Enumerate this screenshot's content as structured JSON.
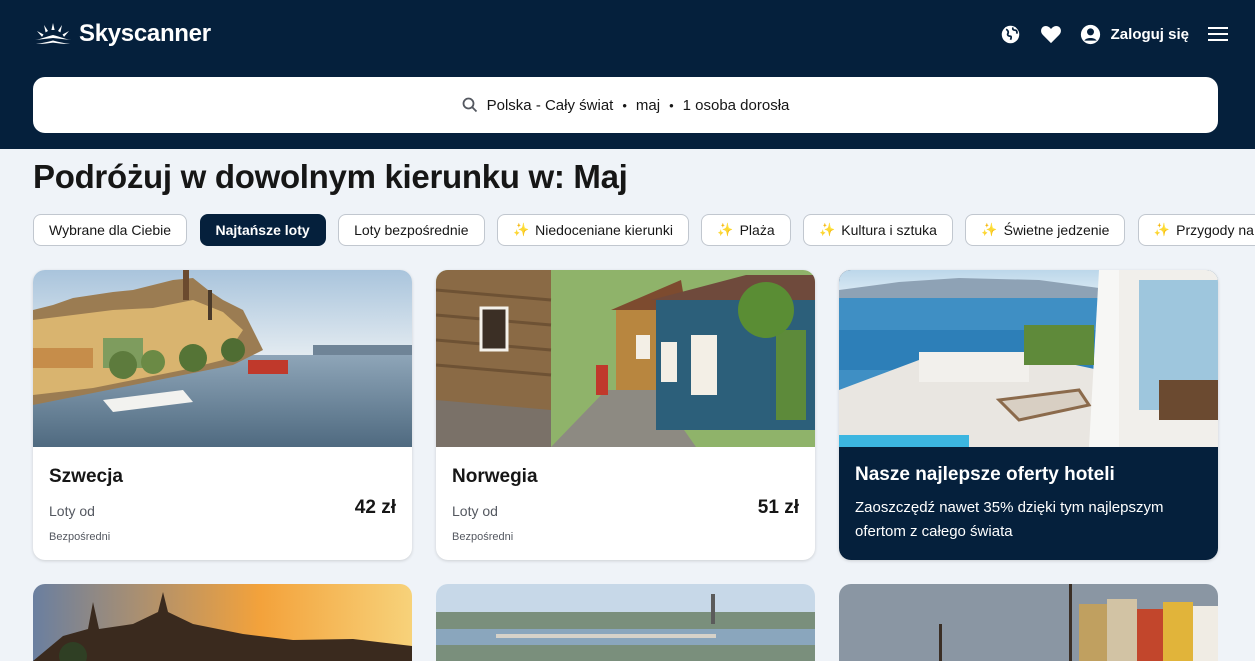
{
  "header": {
    "brand": "Skyscanner",
    "login_label": "Zaloguj się",
    "icons": [
      "globe-icon",
      "heart-icon",
      "user-icon",
      "menu-icon"
    ]
  },
  "search": {
    "route": "Polska - Cały świat",
    "date": "maj",
    "travellers": "1 osoba dorosła",
    "separator": "•"
  },
  "page_title": "Podróżuj w dowolnym kierunku w: Maj",
  "chips": [
    {
      "label": "Wybrane dla Ciebie",
      "active": false,
      "spark": false
    },
    {
      "label": "Najtańsze loty",
      "active": true,
      "spark": false
    },
    {
      "label": "Loty bezpośrednie",
      "active": false,
      "spark": false
    },
    {
      "label": "Niedoceniane kierunki",
      "active": false,
      "spark": true
    },
    {
      "label": "Plaża",
      "active": false,
      "spark": true
    },
    {
      "label": "Kultura i sztuka",
      "active": false,
      "spark": true
    },
    {
      "label": "Świetne jedzenie",
      "active": false,
      "spark": true
    },
    {
      "label": "Przygody na łonie",
      "active": false,
      "spark": true
    }
  ],
  "spark_glyph": "✨",
  "cards": [
    {
      "name": "Szwecja",
      "from_label": "Loty od",
      "price": "42 zł",
      "tag": "Bezpośredni"
    },
    {
      "name": "Norwegia",
      "from_label": "Loty od",
      "price": "51 zł",
      "tag": "Bezpośredni"
    }
  ],
  "hotel_promo": {
    "title": "Nasze najlepsze oferty hoteli",
    "description": "Zaoszczędź nawet 35% dzięki tym najlepszym ofertom z całego świata"
  },
  "colors": {
    "header_bg": "#05203c",
    "page_bg": "#eff3f8",
    "active_chip": "#05203c"
  }
}
